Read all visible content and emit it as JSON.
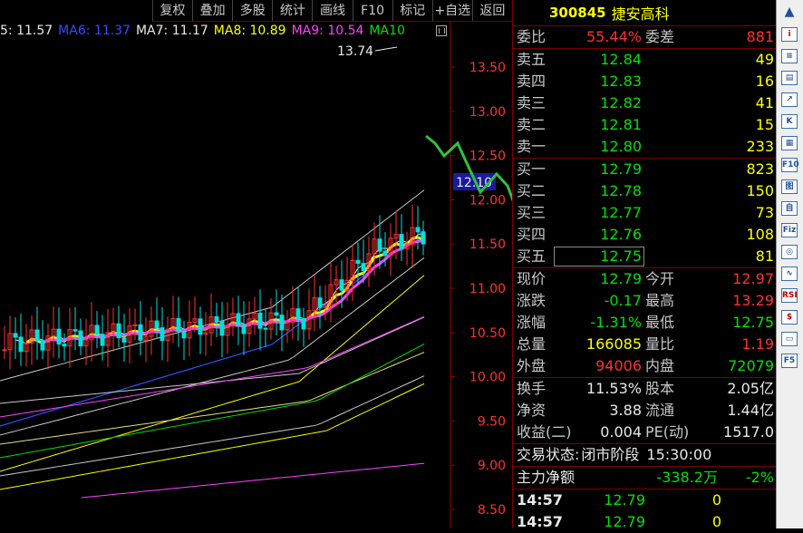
{
  "toolbar_tabs": [
    "复权",
    "叠加",
    "多股",
    "统计",
    "画线",
    "F10",
    "标记",
    "+自选",
    "返回"
  ],
  "legend": [
    {
      "text": "5: 11.57",
      "color": "#e8e8e8"
    },
    {
      "text": "MA6: 11.37",
      "color": "#3050ff"
    },
    {
      "text": "MA7: 11.17",
      "color": "#e8e8e8"
    },
    {
      "text": "MA8: 10.89",
      "color": "#ffff00"
    },
    {
      "text": "MA9: 10.54",
      "color": "#ff40ff"
    },
    {
      "text": "MA10",
      "color": "#00e000"
    }
  ],
  "chart": {
    "high_label": "13.74",
    "current_price_tag": "12.10",
    "price_axis": [
      "13.50",
      "13.00",
      "12.50",
      "12.00",
      "11.50",
      "11.00",
      "10.50",
      "10.00",
      "9.50",
      "9.00",
      "8.50"
    ],
    "price_axis_values": [
      13.5,
      13.0,
      12.5,
      12.0,
      11.5,
      11.0,
      10.5,
      10.0,
      9.5,
      9.0,
      8.5
    ]
  },
  "stock": {
    "code": "300845",
    "name": "捷安高科"
  },
  "ratio": {
    "label": "委比",
    "value": "55.44%",
    "label2": "委差",
    "value2": "881"
  },
  "sell": [
    {
      "label": "卖五",
      "price": "12.84",
      "vol": "49"
    },
    {
      "label": "卖四",
      "price": "12.83",
      "vol": "16"
    },
    {
      "label": "卖三",
      "price": "12.82",
      "vol": "41"
    },
    {
      "label": "卖二",
      "price": "12.81",
      "vol": "15"
    },
    {
      "label": "卖一",
      "price": "12.80",
      "vol": "233"
    }
  ],
  "buy": [
    {
      "label": "买一",
      "price": "12.79",
      "vol": "823"
    },
    {
      "label": "买二",
      "price": "12.78",
      "vol": "150"
    },
    {
      "label": "买三",
      "price": "12.77",
      "vol": "73"
    },
    {
      "label": "买四",
      "price": "12.76",
      "vol": "108"
    },
    {
      "label": "买五",
      "price": "12.75",
      "vol": "81"
    }
  ],
  "stats": [
    {
      "l1": "现价",
      "v1": "12.79",
      "c1": "green",
      "l2": "今开",
      "v2": "12.97",
      "c2": "red"
    },
    {
      "l1": "涨跌",
      "v1": "-0.17",
      "c1": "green",
      "l2": "最高",
      "v2": "13.29",
      "c2": "red"
    },
    {
      "l1": "涨幅",
      "v1": "-1.31%",
      "c1": "green",
      "l2": "最低",
      "v2": "12.75",
      "c2": "green"
    },
    {
      "l1": "总量",
      "v1": "166085",
      "c1": "yellow",
      "l2": "量比",
      "v2": "1.19",
      "c2": "red"
    },
    {
      "l1": "外盘",
      "v1": "94006",
      "c1": "red",
      "l2": "内盘",
      "v2": "72079",
      "c2": "green"
    }
  ],
  "fundamentals": [
    {
      "l1": "换手",
      "v1": "11.53%",
      "l2": "股本",
      "v2": "2.05亿"
    },
    {
      "l1": "净资",
      "v1": "3.88",
      "l2": "流通",
      "v2": "1.44亿"
    },
    {
      "l1": "收益(二)",
      "v1": "0.004",
      "l2": "PE(动)",
      "v2": "1517.0"
    }
  ],
  "status": {
    "label": "交易状态:",
    "value": "闭市阶段",
    "time": "15:30:00"
  },
  "netflow": {
    "label": "主力净额",
    "value": "-338.2万",
    "pct": "-2%"
  },
  "ticks": [
    {
      "time": "14:57",
      "price": "12.79",
      "vol": "0"
    },
    {
      "time": "14:57",
      "price": "12.79",
      "vol": "0"
    }
  ],
  "side_tools": [
    "▲",
    "i",
    "≡",
    "▤",
    "↗",
    "K",
    "▦",
    "F10",
    "图",
    "自",
    "Fiz",
    "◎",
    "∿",
    "RSI",
    "$",
    "▭",
    "F5"
  ]
}
